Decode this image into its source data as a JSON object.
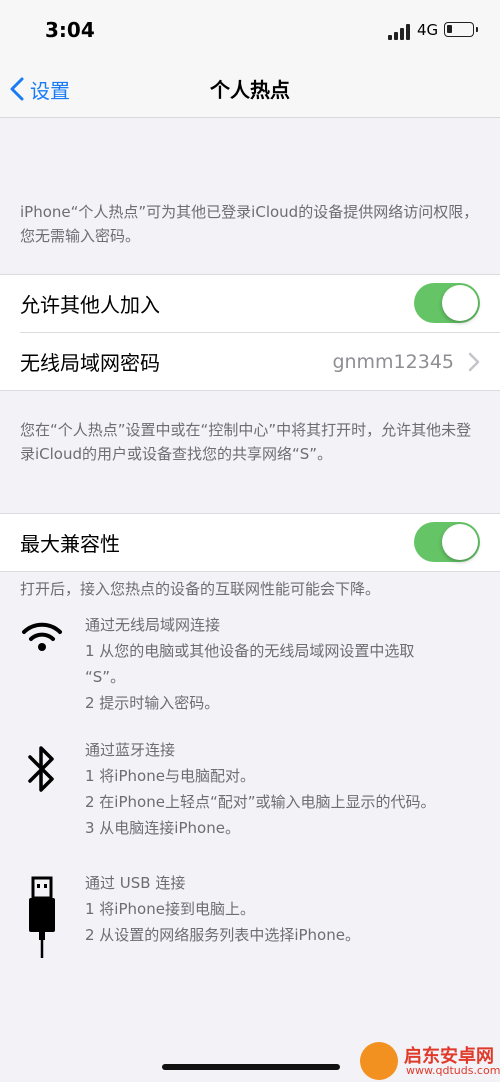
{
  "status_bar": {
    "time": "3:04",
    "network": "4G"
  },
  "nav": {
    "back_label": "设置",
    "title": "个人热点"
  },
  "info_text": "iPhone“个人热点”可为其他已登录iCloud的设备提供网络访问权限，您无需输入密码。",
  "settings_group": {
    "allow_others": {
      "label": "允许其他人加入",
      "enabled": true
    },
    "wifi_password": {
      "label": "无线局域网密码",
      "value": "gnmm12345"
    }
  },
  "discover_text": "您在“个人热点”设置中或在“控制中心”中将其打开时，允许其他未登录iCloud的用户或设备查找您的共享网络“S”。",
  "compat_group": {
    "max_compat": {
      "label": "最大兼容性",
      "enabled": true
    }
  },
  "compat_text": "打开后，接入您热点的设备的互联网性能可能会下降。",
  "methods": {
    "wifi": {
      "title": "通过无线局域网连接",
      "step1": "1 从您的电脑或其他设备的无线局域网设置中选取",
      "step1b": "“S”。",
      "step2": "2 提示时输入密码。"
    },
    "bluetooth": {
      "title": "通过蓝牙连接",
      "step1": "1 将iPhone与电脑配对。",
      "step2": "2 在iPhone上轻点“配对”或输入电脑上显示的代码。",
      "step3": "3 从电脑连接iPhone。"
    },
    "usb": {
      "title": "通过 USB 连接",
      "step1": "1 将iPhone接到电脑上。",
      "step2": "2 从设置的网络服务列表中选择iPhone。"
    }
  },
  "watermark": {
    "name": "启东安卓网",
    "url": "www.qdtuds.com"
  },
  "colors": {
    "accent": "#1a7cf5",
    "toggle_on": "#65c466",
    "secondary_text": "#6d6d72"
  }
}
